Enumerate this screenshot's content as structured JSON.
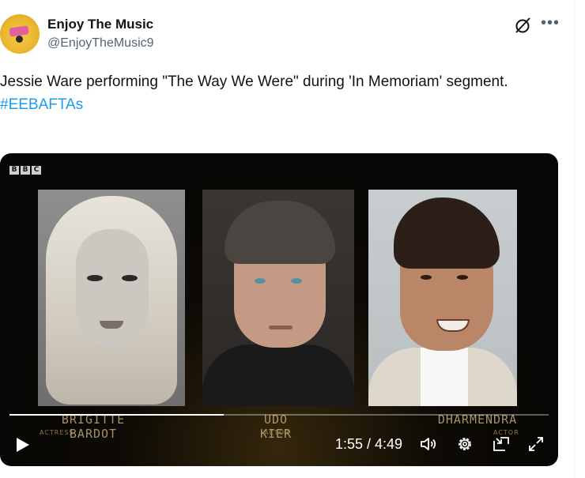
{
  "author": {
    "name": "Enjoy The Music",
    "handle": "@EnjoyTheMusic9"
  },
  "header_icons": [
    "grok-icon",
    "more-icon"
  ],
  "tweet": {
    "text": "Jessie Ware performing \"The Way We Were\" during 'In Memoriam' segment.",
    "hashtag": "#EEBAFTAs"
  },
  "video": {
    "broadcaster_logo": [
      "B",
      "B",
      "C"
    ],
    "tributes": [
      {
        "name": "BRIGITTE BARDOT",
        "role": "ACTRESS"
      },
      {
        "name": "UDO KIER",
        "role": "ACTOR"
      },
      {
        "name": "DHARMENDRA",
        "role": "ACTOR"
      }
    ],
    "time_display": "1:55 / 4:49",
    "progress_fraction": 0.398,
    "controls": [
      "play-icon",
      "volume-icon",
      "settings-icon",
      "picture-in-picture-icon",
      "fullscreen-icon"
    ]
  },
  "colors": {
    "text_primary": "#0f1419",
    "text_secondary": "#536471",
    "link": "#1d9bf0",
    "video_background": "#070604"
  }
}
